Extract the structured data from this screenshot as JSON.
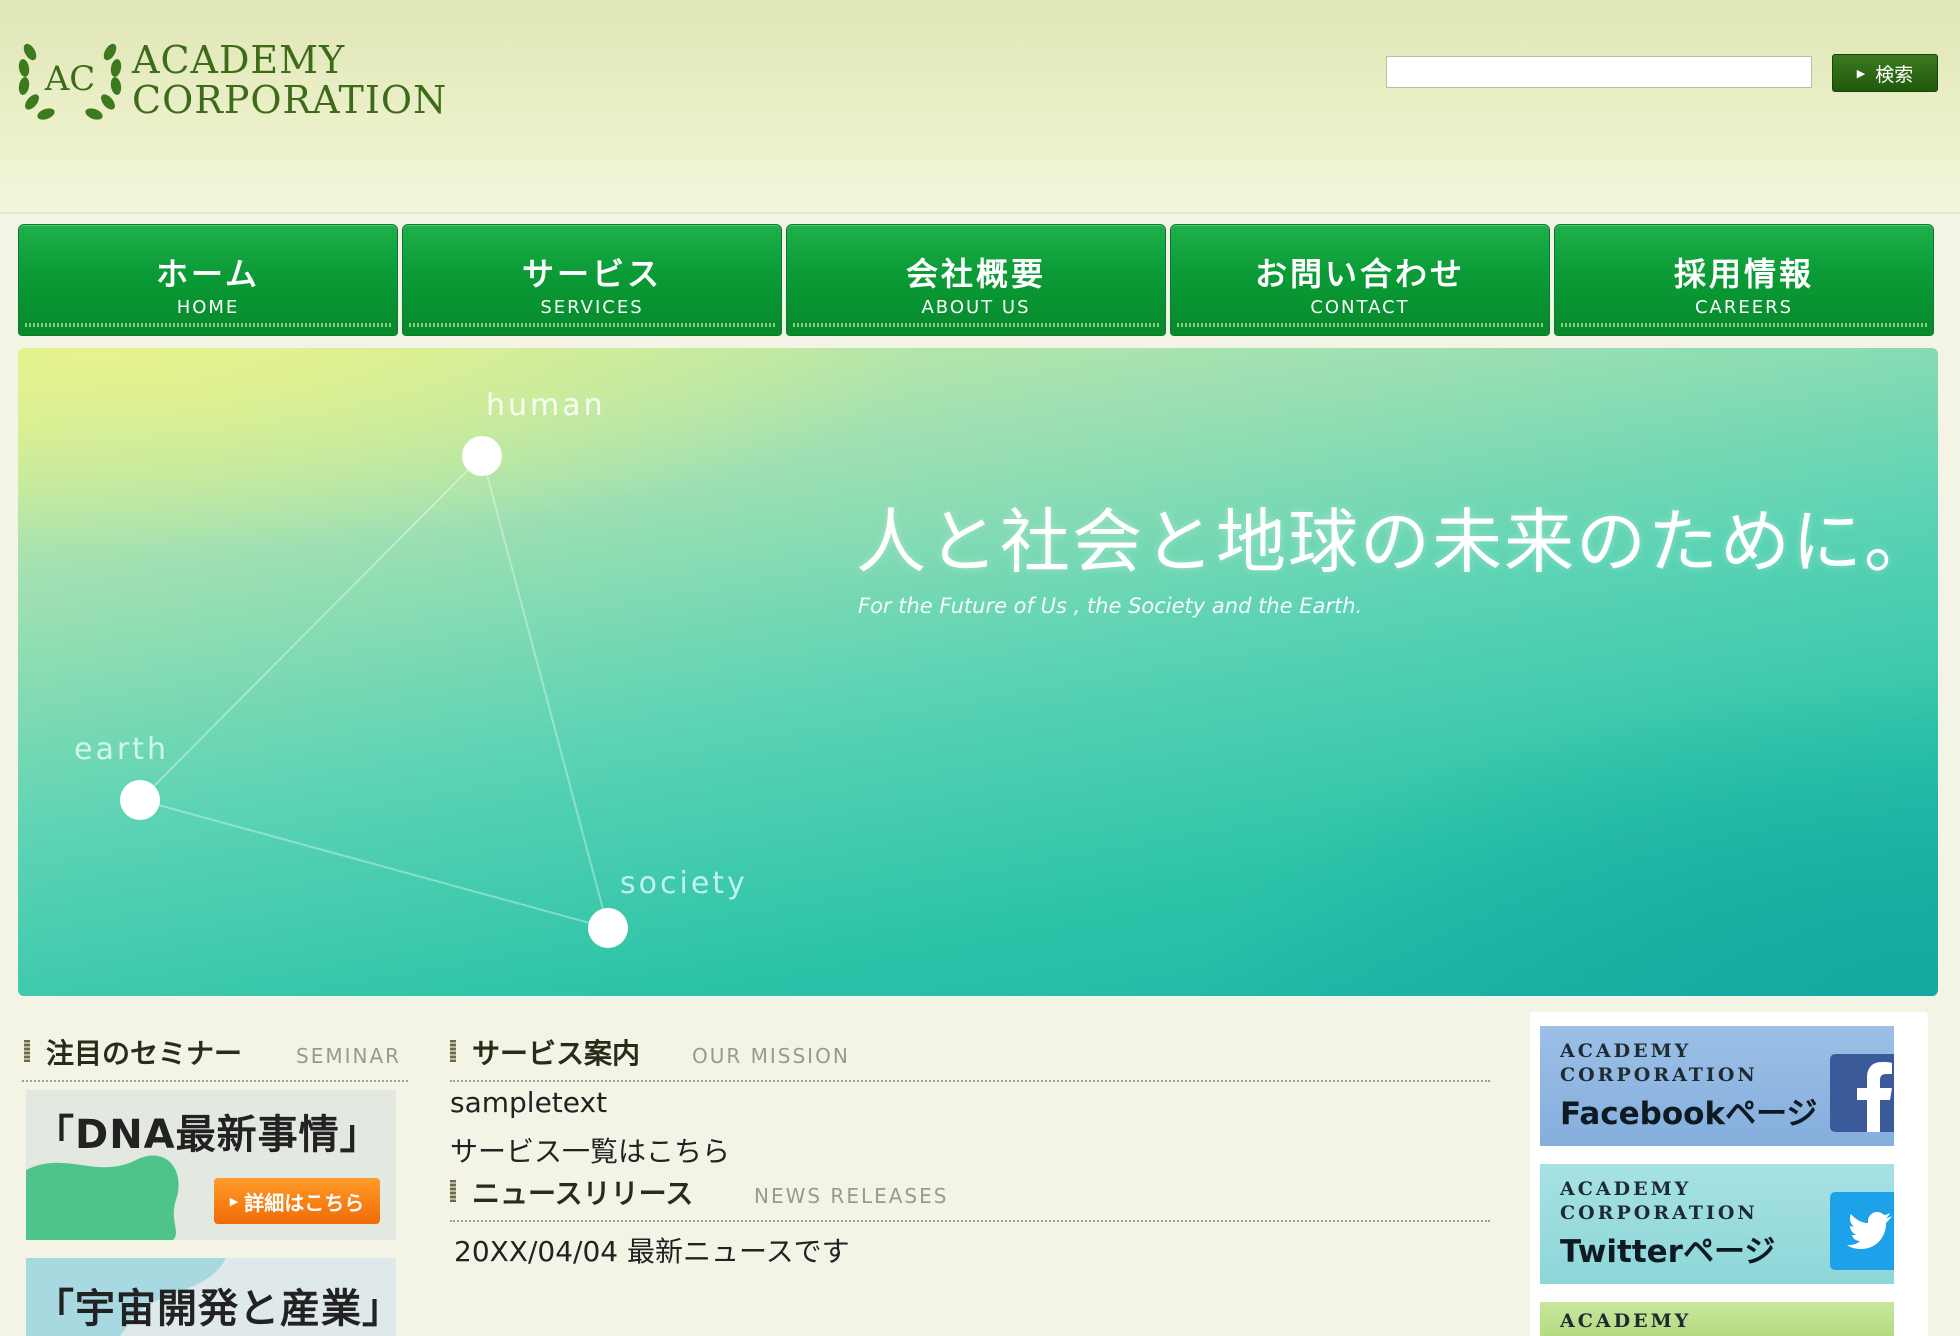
{
  "header": {
    "logo": {
      "line1": "ACADEMY",
      "line2": "CORPORATION",
      "mark_text": "AC"
    },
    "search": {
      "value": "",
      "button_label": "検索"
    }
  },
  "nav": {
    "items": [
      {
        "jp": "ホーム",
        "en": "HOME"
      },
      {
        "jp": "サービス",
        "en": "SERVICES"
      },
      {
        "jp": "会社概要",
        "en": "ABOUT US"
      },
      {
        "jp": "お問い合わせ",
        "en": "CONTACT"
      },
      {
        "jp": "採用情報",
        "en": "CAREERS"
      }
    ]
  },
  "hero": {
    "title": "人と社会と地球の未来のために。",
    "subtitle": "For the Future of Us , the Society and the Earth.",
    "nodes": {
      "human": "human",
      "earth": "earth",
      "society": "society"
    }
  },
  "seminar": {
    "heading_jp": "注目のセミナー",
    "heading_en": "SEMINAR",
    "cards": [
      {
        "title": "「DNA最新事情」",
        "button": "詳細はこちら"
      },
      {
        "title": "「宇宙開発と産業」"
      }
    ]
  },
  "services": {
    "heading_jp": "サービス案内",
    "heading_en": "OUR MISSION",
    "text": "sampletext",
    "link": "サービス一覧はこちら"
  },
  "news": {
    "heading_jp": "ニュースリリース",
    "heading_en": "NEWS RELEASES",
    "items": [
      {
        "date": "20XX/04/04",
        "text": "最新ニュースです"
      }
    ]
  },
  "social": {
    "facebook": {
      "line1": "ACADEMY",
      "line2": "CORPORATION",
      "line3": "Facebookページ",
      "icon": "facebook-icon"
    },
    "twitter": {
      "line1": "ACADEMY",
      "line2": "CORPORATION",
      "line3": "Twitterページ",
      "icon": "twitter-icon"
    },
    "third": {
      "line1": "ACADEMY"
    }
  },
  "colors": {
    "nav_green": "#0a9b36",
    "accent_orange": "#f06b06",
    "logo_green": "#3d6b1a"
  }
}
